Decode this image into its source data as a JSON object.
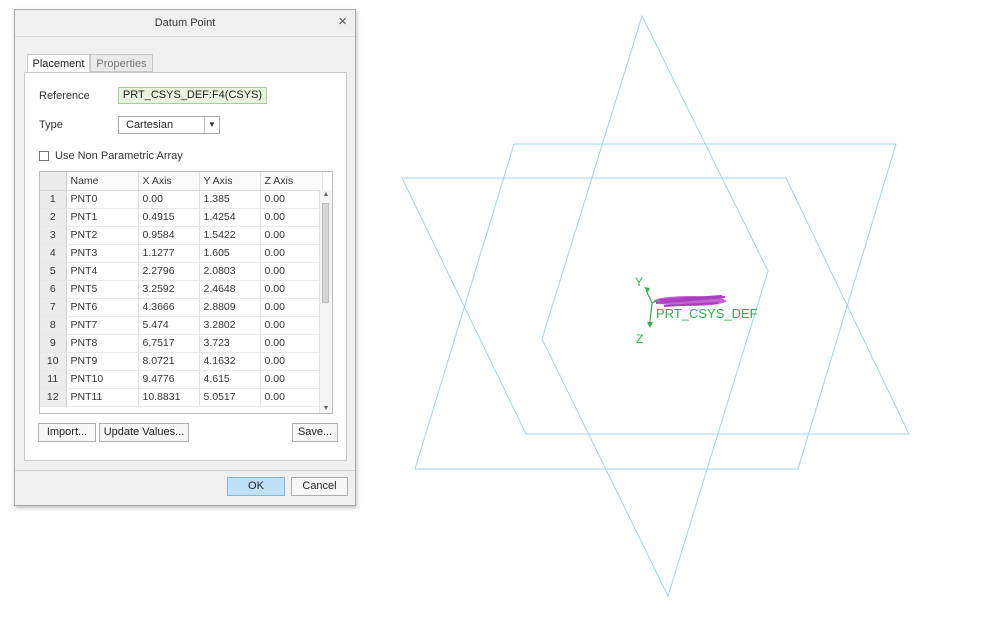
{
  "dialog": {
    "title": "Datum Point",
    "close_symbol": "×",
    "tabs": [
      {
        "label": "Placement",
        "active": true
      },
      {
        "label": "Properties",
        "active": false
      }
    ],
    "reference_label": "Reference",
    "reference_value": "PRT_CSYS_DEF:F4(CSYS)",
    "type_label": "Type",
    "type_value": "Cartesian",
    "checkbox_label": "Use Non Parametric Array",
    "checkbox_checked": false,
    "table": {
      "columns": [
        "Name",
        "X Axis",
        "Y Axis",
        "Z Axis"
      ],
      "rows": [
        {
          "n": "1",
          "name": "PNT0",
          "x": "0.00",
          "y": "1.385",
          "z": "0.00"
        },
        {
          "n": "2",
          "name": "PNT1",
          "x": "0.4915",
          "y": "1.4254",
          "z": "0.00"
        },
        {
          "n": "3",
          "name": "PNT2",
          "x": "0.9584",
          "y": "1.5422",
          "z": "0.00"
        },
        {
          "n": "4",
          "name": "PNT3",
          "x": "1.1277",
          "y": "1.605",
          "z": "0.00"
        },
        {
          "n": "5",
          "name": "PNT4",
          "x": "2.2796",
          "y": "2.0803",
          "z": "0.00"
        },
        {
          "n": "6",
          "name": "PNT5",
          "x": "3.2592",
          "y": "2.4648",
          "z": "0.00"
        },
        {
          "n": "7",
          "name": "PNT6",
          "x": "4.3666",
          "y": "2.8809",
          "z": "0.00"
        },
        {
          "n": "8",
          "name": "PNT7",
          "x": "5.474",
          "y": "3.2802",
          "z": "0.00"
        },
        {
          "n": "9",
          "name": "PNT8",
          "x": "6.7517",
          "y": "3.723",
          "z": "0.00"
        },
        {
          "n": "10",
          "name": "PNT9",
          "x": "8.0721",
          "y": "4.1632",
          "z": "0.00"
        },
        {
          "n": "11",
          "name": "PNT10",
          "x": "9.4776",
          "y": "4.615",
          "z": "0.00"
        },
        {
          "n": "12",
          "name": "PNT11",
          "x": "10.8831",
          "y": "5.0517",
          "z": "0.00"
        }
      ]
    },
    "buttons": {
      "import": "Import...",
      "update": "Update Values...",
      "save": "Save...",
      "ok": "OK",
      "cancel": "Cancel"
    }
  },
  "viewport": {
    "csys_label": "PRT_CSYS_DEF",
    "axis_y": "Y",
    "axis_z": "Z",
    "colors": {
      "plane_edge": "#9fd3ee",
      "csys": "#2fae4e",
      "points": "#c04fd0"
    }
  },
  "icons": [
    "close-icon",
    "dropdown-arrow-icon",
    "checkbox-icon",
    "scroll-up-icon",
    "scroll-down-icon",
    "mouse-cursor-icon"
  ]
}
